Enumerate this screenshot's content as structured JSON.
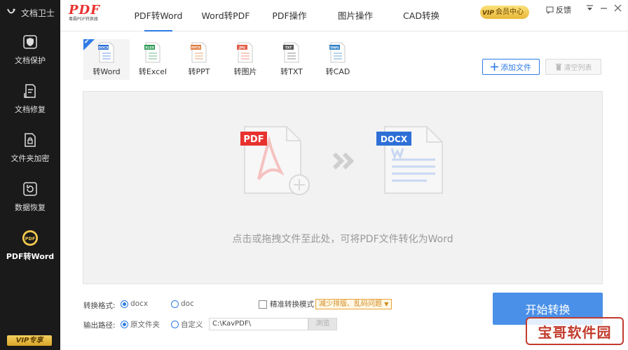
{
  "sidebar": {
    "brand": "文档卫士",
    "items": [
      {
        "label": "文档保护",
        "icon": "shield-icon"
      },
      {
        "label": "文档修复",
        "icon": "document-repair-icon"
      },
      {
        "label": "文件夹加密",
        "icon": "folder-lock-icon"
      },
      {
        "label": "数据恢复",
        "icon": "restore-icon"
      },
      {
        "label": "PDF转Word",
        "icon": "pdf-convert-icon",
        "active": true
      }
    ],
    "vip_label": "VIP专享"
  },
  "header": {
    "logo_text": "PDF",
    "logo_sub": "毒霸PDF转换器",
    "tabs": [
      {
        "label": "PDF转Word",
        "active": true
      },
      {
        "label": "Word转PDF"
      },
      {
        "label": "PDF操作"
      },
      {
        "label": "图片操作"
      },
      {
        "label": "CAD转换"
      }
    ],
    "vip_center": "会员中心",
    "vip_mark": "VIP",
    "feedback": "反馈"
  },
  "conv_tabs": [
    {
      "label": "转Word",
      "tag": "DOCX",
      "color": "#2d6fd6",
      "active": true
    },
    {
      "label": "转Excel",
      "tag": "XLSX",
      "color": "#2e9a57"
    },
    {
      "label": "转PPT",
      "tag": "PPTX",
      "color": "#e07a3a"
    },
    {
      "label": "转图片",
      "tag": "JPG",
      "color": "#e35d4a"
    },
    {
      "label": "转TXT",
      "tag": "TXT",
      "color": "#555555"
    },
    {
      "label": "转CAD",
      "tag": "DWG",
      "color": "#2a7fc4"
    }
  ],
  "actions": {
    "add_file": "添加文件",
    "clear_list": "清空列表"
  },
  "dropzone": {
    "source_badge": "PDF",
    "target_badge": "DOCX",
    "hint": "点击或拖拽文件至此处，可将PDF文件转化为Word"
  },
  "settings": {
    "format_label": "转换格式:",
    "format_options": [
      "docx",
      "doc"
    ],
    "format_selected": "docx",
    "precise_label": "精准转换模式",
    "precise_note": "减少排版、乱码问题",
    "output_label": "输出路径:",
    "output_options": [
      "原文件夹",
      "自定义"
    ],
    "output_selected": "原文件夹",
    "path_value": "C:\\KavPDF\\",
    "browse": "浏览",
    "start": "开始转换"
  },
  "watermark": "宝哥软件园",
  "colors": {
    "accent": "#2d7be5",
    "sidebar_bg": "#1a1a1a",
    "pdf_red": "#e8312e",
    "docx_blue": "#2d6fd6",
    "vip_gold": "#e9b637"
  }
}
